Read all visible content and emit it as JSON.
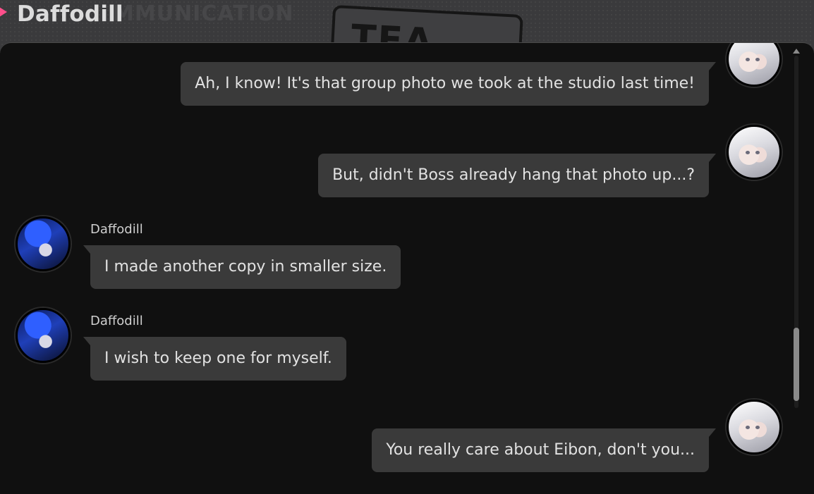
{
  "header": {
    "contact_name": "Daffodill",
    "background_watermark": "MMUNICATION",
    "badge_text": "TE A​·",
    "small_print": ""
  },
  "messages": [
    {
      "side": "out",
      "text": "Ah, I know! It's that group photo we took at the studio last time!"
    },
    {
      "side": "out",
      "text": "But, didn't Boss already hang that photo up...?"
    },
    {
      "side": "in",
      "sender": "Daffodill",
      "text": "I made another copy in smaller size."
    },
    {
      "side": "in",
      "sender": "Daffodill",
      "text": "I wish to keep one for myself."
    },
    {
      "side": "out",
      "text": "You really care about Eibon, don't you..."
    }
  ],
  "avatars": {
    "self": "white-haired-avatar",
    "contact": "blue-haired-avatar"
  },
  "colors": {
    "accent": "#ff4f8b",
    "panel": "#101010",
    "bubble": "#3a3a3a",
    "text": "#e2e2e2"
  }
}
